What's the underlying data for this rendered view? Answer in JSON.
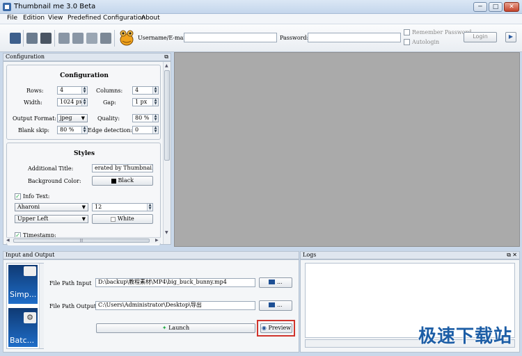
{
  "window": {
    "title": "Thumbnail me 3.0 Beta",
    "min": "─",
    "max": "□",
    "close": "✕"
  },
  "menu": [
    "File",
    "Edition",
    "View",
    "Predefined Configuration",
    "About"
  ],
  "toolbar": {
    "username_label": "Username/E-mail:",
    "username_value": "",
    "password_label": "Password:",
    "password_value": "",
    "remember_label": "Remember Password",
    "autologin_label": "Autologin",
    "login_label": "Login",
    "arrow_glyph": "▶"
  },
  "config": {
    "panel_title": "Configuration",
    "section_title": "Configuration",
    "rows_label": "Rows:",
    "rows_value": "4",
    "columns_label": "Columns:",
    "columns_value": "4",
    "width_label": "Width:",
    "width_value": "1024 px",
    "gap_label": "Gap:",
    "gap_value": "1 px",
    "output_format_label": "Output Format:",
    "output_format_value": "jpeg",
    "quality_label": "Quality:",
    "quality_value": "80 %",
    "blank_skip_label": "Blank skip:",
    "blank_skip_value": "80 %",
    "edge_detection_label": "Edge detection:",
    "edge_detection_value": "0",
    "styles_title": "Styles",
    "additional_title_label": "Additional Title:",
    "additional_title_value": "erated by Thumbnail me",
    "bg_color_label": "Background Color:",
    "bg_color_value": "Black",
    "info_text_label": "Info Text:",
    "font_value": "Aharoni",
    "font_size_value": "12",
    "position_value": "Upper Left",
    "text_color_value": "White",
    "timestamp_label": "Timestamp:",
    "check_glyph": "✓",
    "hscroll_grip": "|||"
  },
  "io": {
    "panel_title": "Input and Output",
    "file_input_label": "File Path Input",
    "file_input_value": "D:\\backup\\教程素材\\MP4\\big_buck_bunny.mp4",
    "file_output_label": "File Path Output",
    "file_output_value": "C:\\Users\\Administrator\\Desktop\\导出",
    "browse_label": "...",
    "launch_label": "Launch",
    "preview_label": "Preview",
    "side_items": [
      "Simp...",
      "Batc..."
    ]
  },
  "logs": {
    "panel_title": "Logs"
  },
  "watermark": "极速下载站",
  "colors": {
    "preview_bg": "#aaaaaa",
    "highlight": "#d0342c"
  }
}
